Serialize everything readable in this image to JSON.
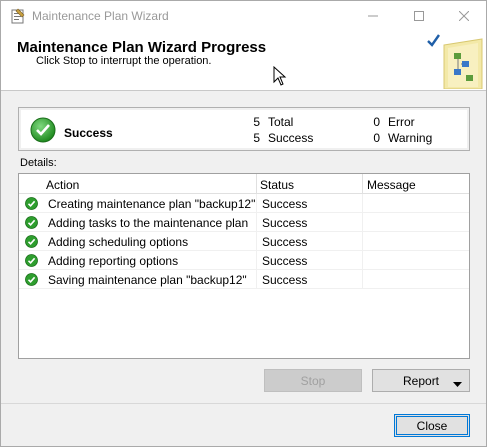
{
  "window": {
    "title": "Maintenance Plan Wizard"
  },
  "header": {
    "title": "Maintenance Plan Wizard Progress",
    "subtitle": "Click Stop to interrupt the operation."
  },
  "summary": {
    "status": "Success",
    "total_count": "5",
    "total_label": "Total",
    "success_count": "5",
    "success_label": "Success",
    "error_count": "0",
    "error_label": "Error",
    "warning_count": "0",
    "warning_label": "Warning"
  },
  "details": {
    "label": "Details:",
    "columns": [
      "Action",
      "Status",
      "Message"
    ],
    "rows": [
      {
        "action": "Creating maintenance plan \"backup12\"",
        "status": "Success",
        "message": ""
      },
      {
        "action": "Adding tasks to the maintenance plan",
        "status": "Success",
        "message": ""
      },
      {
        "action": "Adding scheduling options",
        "status": "Success",
        "message": ""
      },
      {
        "action": "Adding reporting options",
        "status": "Success",
        "message": ""
      },
      {
        "action": "Saving maintenance plan \"backup12\"",
        "status": "Success",
        "message": ""
      }
    ]
  },
  "buttons": {
    "stop": "Stop",
    "report": "Report",
    "close": "Close"
  },
  "colors": {
    "success_green": "#2e9e2e",
    "accent_blue": "#0078d7"
  }
}
